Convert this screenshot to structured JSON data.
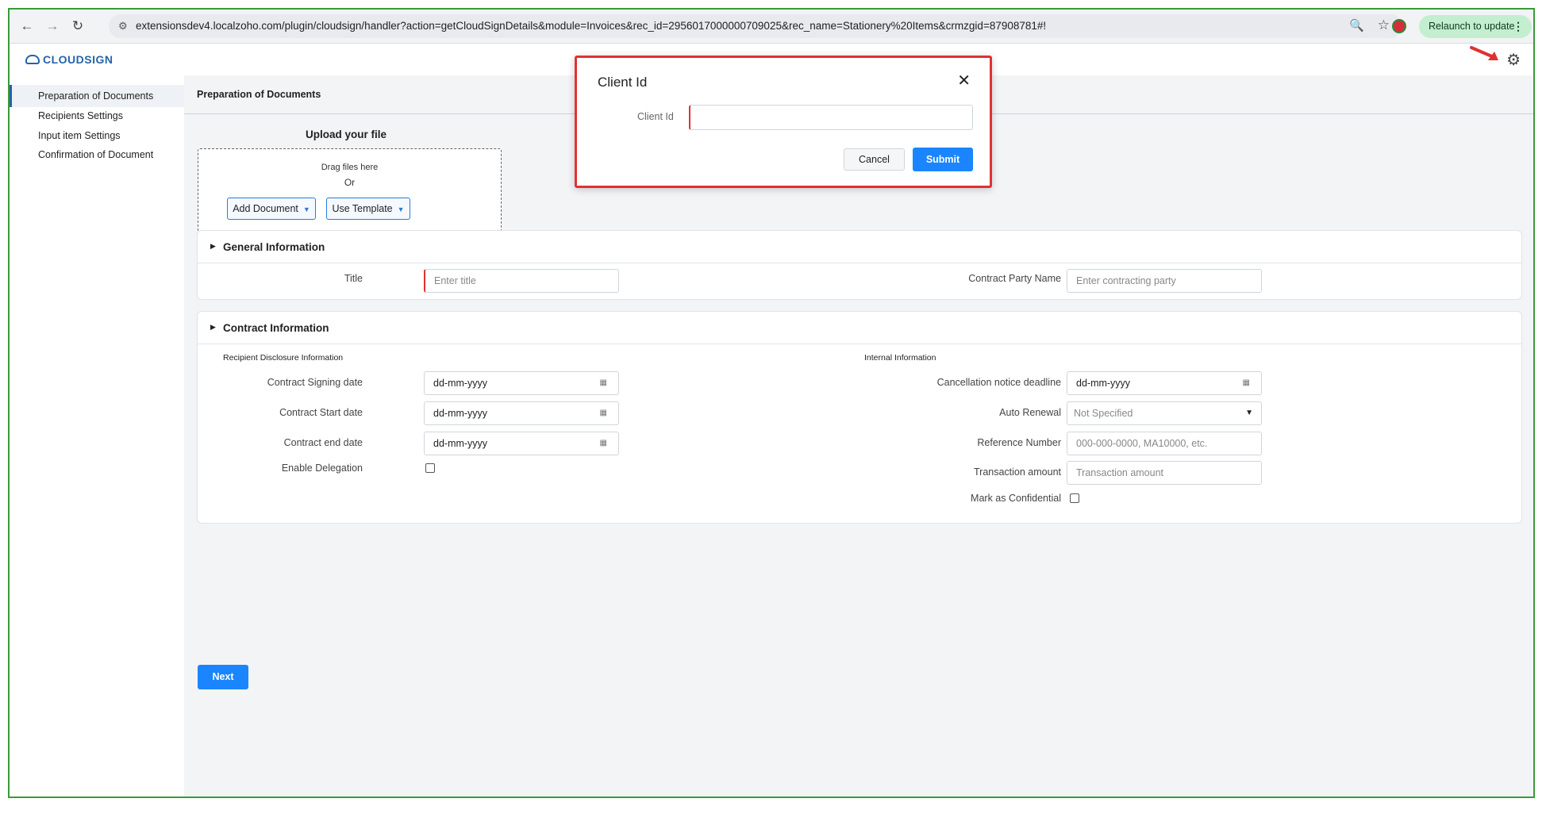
{
  "browser": {
    "url": "extensionsdev4.localzoho.com/plugin/cloudsign/handler?action=getCloudSignDetails&module=Invoices&rec_id=2956017000000709025&rec_name=Stationery%20Items&crmzgid=87908781#!",
    "relaunch_label": "Relaunch to update",
    "back": "←",
    "forward": "→",
    "reload": "↻",
    "site_info": "⚙",
    "zoom": "🔍",
    "star": "☆",
    "menu": "⋮"
  },
  "app": {
    "logo_text": "CLOUDSIGN",
    "gear": "⚙"
  },
  "sidebar": {
    "items": [
      {
        "label": "Preparation of Documents"
      },
      {
        "label": "Recipients Settings"
      },
      {
        "label": "Input item Settings"
      },
      {
        "label": "Confirmation of Document"
      }
    ]
  },
  "content": {
    "title": "Preparation of Documents",
    "upload": {
      "title": "Upload your file",
      "drag": "Drag files here",
      "or": "Or",
      "add_document": "Add Document",
      "use_template": "Use Template"
    },
    "general": {
      "title": "General Information",
      "title_label": "Title",
      "title_placeholder": "Enter title",
      "party_label": "Contract Party Name",
      "party_placeholder": "Enter contracting party"
    },
    "contract": {
      "title": "Contract Information",
      "recipient_section": "Recipient Disclosure Information",
      "internal_section": "Internal Information",
      "signing_label": "Contract Signing date",
      "start_label": "Contract Start date",
      "end_label": "Contract end date",
      "delegation_label": "Enable Delegation",
      "date_value": "dd-mm-yyyy",
      "cancellation_label": "Cancellation notice deadline",
      "renewal_label": "Auto Renewal",
      "renewal_value": "Not Specified",
      "reference_label": "Reference Number",
      "reference_placeholder": "000-000-0000, MA10000, etc.",
      "amount_label": "Transaction amount",
      "amount_placeholder": "Transaction amount",
      "confidential_label": "Mark as Confidential"
    },
    "next_label": "Next"
  },
  "modal": {
    "title": "Client Id",
    "field_label": "Client Id",
    "field_value": "",
    "cancel_label": "Cancel",
    "submit_label": "Submit",
    "close": "✕"
  },
  "colors": {
    "accent": "#1a85ff",
    "brand": "#2563a8",
    "highlight": "#e03131"
  }
}
